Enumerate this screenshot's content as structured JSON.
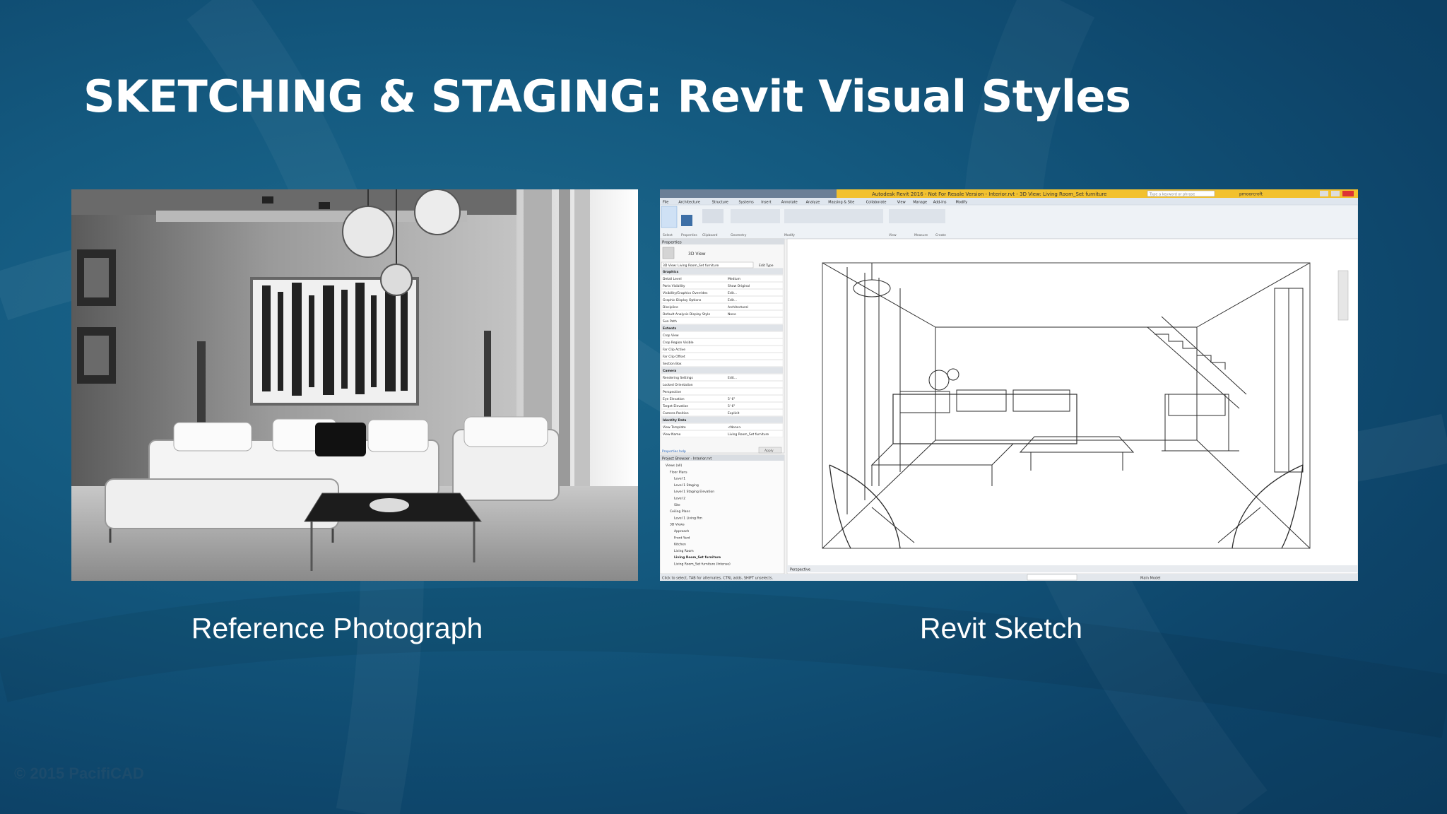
{
  "slide": {
    "title": "SKETCHING & STAGING: Revit Visual Styles",
    "copyright": "© 2015 PacifiCAD"
  },
  "captions": {
    "left": "Reference Photograph",
    "right": "Revit Sketch"
  },
  "colors": {
    "background": "#145a80",
    "revit_titlebar": "#f2c12e",
    "title_text": "#ffffff"
  },
  "revit": {
    "window_title": "Autodesk Revit 2016 - Not For Resale Version -  Interior.rvt - 3D View: Living Room_Set furniture",
    "search_placeholder": "Type a keyword or phrase",
    "user": "pmoorcroft",
    "ribbon_tabs": [
      "File",
      "Architecture",
      "Structure",
      "Systems",
      "Insert",
      "Annotate",
      "Analyze",
      "Massing & Site",
      "Collaborate",
      "View",
      "Manage",
      "Add-Ins",
      "Modify"
    ],
    "ribbon_groups": [
      "Select",
      "Properties",
      "Clipboard",
      "Geometry",
      "Modify",
      "View",
      "Measure",
      "Create"
    ],
    "properties_title": "Properties",
    "properties_type": "3D View",
    "view_selector": "3D View: Living Room_Set furniture",
    "edit_type": "Edit Type",
    "properties_rows": [
      {
        "name": "Graphics",
        "value": ""
      },
      {
        "name": "Detail Level",
        "value": "Medium"
      },
      {
        "name": "Parts Visibility",
        "value": "Show Original"
      },
      {
        "name": "Visibility/Graphics Overrides",
        "value": "Edit..."
      },
      {
        "name": "Graphic Display Options",
        "value": "Edit..."
      },
      {
        "name": "Discipline",
        "value": "Architectural"
      },
      {
        "name": "Default Analysis Display Style",
        "value": "None"
      },
      {
        "name": "Sun Path",
        "value": ""
      },
      {
        "name": "Extents",
        "value": ""
      },
      {
        "name": "Crop View",
        "value": ""
      },
      {
        "name": "Crop Region Visible",
        "value": ""
      },
      {
        "name": "Far Clip Active",
        "value": ""
      },
      {
        "name": "Far Clip Offset",
        "value": ""
      },
      {
        "name": "Section Box",
        "value": ""
      },
      {
        "name": "Camera",
        "value": ""
      },
      {
        "name": "Rendering Settings",
        "value": "Edit..."
      },
      {
        "name": "Locked Orientation",
        "value": ""
      },
      {
        "name": "Perspective",
        "value": ""
      },
      {
        "name": "Eye Elevation",
        "value": "5' 6\""
      },
      {
        "name": "Target Elevation",
        "value": "5' 6\""
      },
      {
        "name": "Camera Position",
        "value": "Explicit"
      },
      {
        "name": "Identity Data",
        "value": ""
      },
      {
        "name": "View Template",
        "value": "<None>"
      },
      {
        "name": "View Name",
        "value": "Living Room_Set furniture"
      }
    ],
    "properties_help": "Properties help",
    "apply": "Apply",
    "browser_title": "Project Browser - Interior.rvt",
    "browser_items": [
      "Views (all)",
      "Floor Plans",
      "Level 1",
      "Level 1 Staging",
      "Level 1 Staging Elevation",
      "Level 2",
      "Site",
      "Ceiling Plans",
      "Level 1 Living Rm",
      "3D Views",
      "Approach",
      "Front Yard",
      "Kitchen",
      "Living Room",
      "Living Room_Set furniture",
      "Living Room_Set furniture (Intense)"
    ],
    "view_scale": "Perspective",
    "status": "Click to select, TAB for alternates, CTRL adds, SHIFT unselects.",
    "model_name": "Main Model"
  }
}
